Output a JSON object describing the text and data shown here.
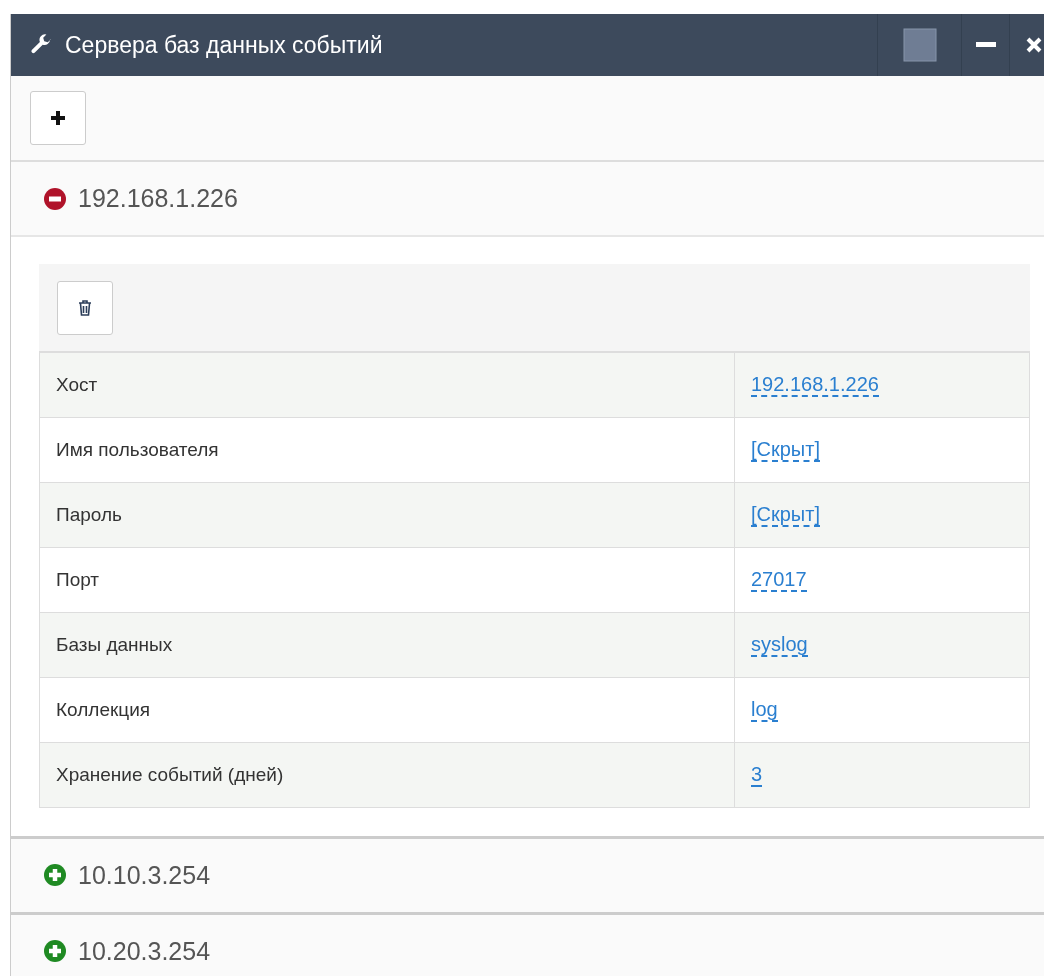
{
  "window": {
    "title": "Сервера баз данных событий"
  },
  "servers": [
    {
      "address": "192.168.1.226",
      "expanded": true,
      "fields": [
        {
          "label": "Хост",
          "value": "192.168.1.226"
        },
        {
          "label": "Имя пользователя",
          "value": "[Скрыт]"
        },
        {
          "label": "Пароль",
          "value": "[Скрыт]"
        },
        {
          "label": "Порт",
          "value": "27017"
        },
        {
          "label": "Базы данных",
          "value": "syslog"
        },
        {
          "label": "Коллекция",
          "value": "log"
        },
        {
          "label": "Хранение событий (дней)",
          "value": "3"
        }
      ]
    },
    {
      "address": "10.10.3.254",
      "expanded": false
    },
    {
      "address": "10.20.3.254",
      "expanded": false
    }
  ]
}
